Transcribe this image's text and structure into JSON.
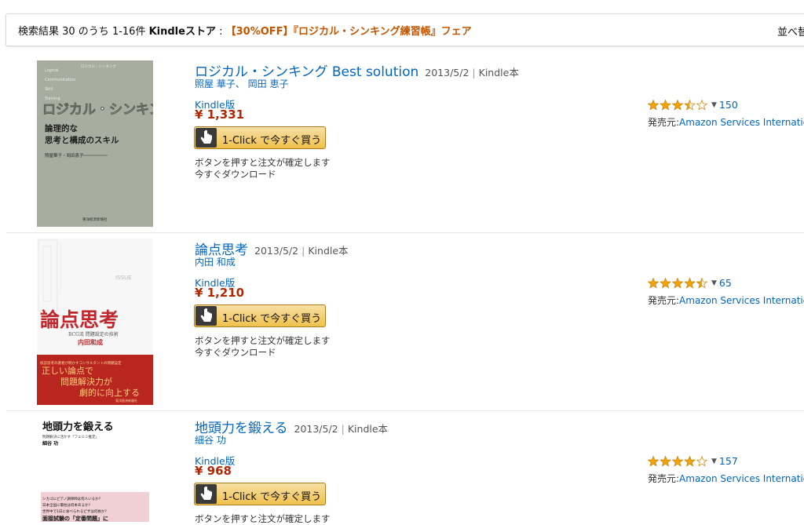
{
  "header": {
    "count_text": "検索結果 30 のうち 1-16件",
    "store": "Kindleストア",
    "colon": " : ",
    "promo": "【30%OFF】『ロジカル・シンキング練習帳』フェア",
    "sort_label": "並べ替"
  },
  "colors": {
    "link": "#0066c0",
    "price": "#b12704",
    "promo": "#c45500",
    "star": "#f1a40e",
    "button": "#f0c14b"
  },
  "items": [
    {
      "title": "ロジカル・シンキング Best solution",
      "date": "2013/5/2",
      "separator": "|",
      "kind": "Kindle本",
      "authors": "照屋 華子、 岡田 恵子",
      "format": "Kindle版",
      "price": "¥ 1,331",
      "buy_label": "1-Click で今すぐ買う",
      "note1": "ボタンを押すと注文が確定します",
      "note2": "今すぐダウンロード",
      "rating": 3.5,
      "rating_count": "150",
      "seller_prefix": "発売元:",
      "seller": "Amazon Services International",
      "cover": {
        "small_en": [
          "Logical",
          "Communication",
          "Skill",
          "Training"
        ],
        "top_caption": "ロジカル・シンキング",
        "big_title": "ロジカル・シンキング",
        "sub1": "論理的な",
        "sub2": "思考と構成のスキル",
        "cover_author": "照屋華子・岡田恵子",
        "publisher": "東洋経済新報社"
      }
    },
    {
      "title": "論点思考",
      "date": "2013/5/2",
      "separator": "|",
      "kind": "Kindle本",
      "authors": "内田 和成",
      "format": "Kindle版",
      "price": "¥ 1,210",
      "buy_label": "1-Click で今すぐ買う",
      "note1": "ボタンを押すと注文が確定します",
      "note2": "今すぐダウンロード",
      "rating": 4.5,
      "rating_count": "65",
      "seller_prefix": "発売元:",
      "seller": "Amazon Services International",
      "cover": {
        "big_title": "論点思考",
        "sub": "BCG流 問題設定の技術",
        "cover_author": "内田和成",
        "band_small": "仮説思考の著者が明かすコンサルタントの問題設定",
        "band_big1": "正しい論点で",
        "band_big2": "問題解決力が",
        "band_big3": "劇的に向上する",
        "publisher": "東洋経済新報社"
      }
    },
    {
      "title": "地頭力を鍛える",
      "date": "2013/5/2",
      "separator": "|",
      "kind": "Kindle本",
      "authors": "細谷 功",
      "format": "Kindle版",
      "price": "¥ 968",
      "buy_label": "1-Click で今すぐ買う",
      "note1": "ボタンを押すと注文が確定します",
      "note2": "",
      "rating": 4.0,
      "rating_count": "157",
      "seller_prefix": "発売元:",
      "seller": "Amazon Services International",
      "cover": {
        "big_title": "地頭力を鍛える",
        "sub": "問題解決に活かす「フェルミ推定」",
        "cover_author": "細谷 功",
        "q1": "シカゴにピアノ調律師は何人いるか?",
        "q2": "日本全国に電柱は何本あるか?",
        "q3": "世界中で1日に食べられるピザは何枚か?",
        "band": "面接試験の「定番問題」に"
      }
    }
  ]
}
